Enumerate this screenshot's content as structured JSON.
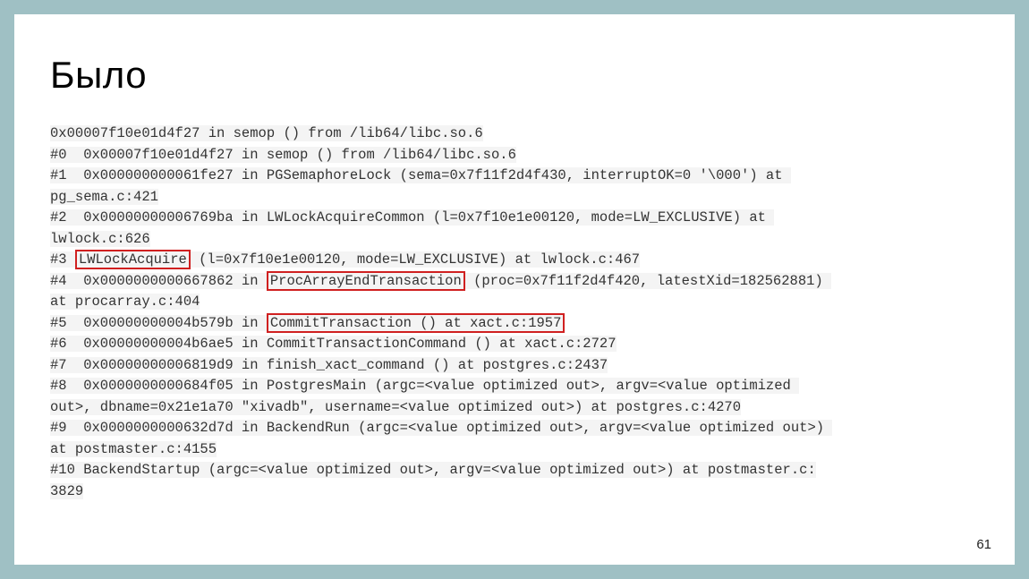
{
  "title": "Было",
  "page_number": "61",
  "stack": {
    "l0": "0x00007f10e01d4f27 in semop () from /lib64/libc.so.6",
    "l1": "#0  0x00007f10e01d4f27 in semop () from /lib64/libc.so.6",
    "l2": "#1  0x000000000061fe27 in PGSemaphoreLock (sema=0x7f11f2d4f430, interruptOK=0 '\\000') at ",
    "l2b": "pg_sema.c:421",
    "l3": "#2  0x00000000006769ba in LWLockAcquireCommon (l=0x7f10e1e00120, mode=LW_EXCLUSIVE) at ",
    "l3b": "lwlock.c:626",
    "l4a": "#3 ",
    "l4h": "LWLockAcquire",
    "l4b": " (l=0x7f10e1e00120, mode=LW_EXCLUSIVE) at lwlock.c:467",
    "l5a": "#4  0x0000000000667862 in ",
    "l5h": "ProcArrayEndTransaction",
    "l5b": " (proc=0x7f11f2d4f420, latestXid=182562881) ",
    "l5c": "at procarray.c:404",
    "l6a": "#5  0x00000000004b579b in ",
    "l6h": "CommitTransaction () at xact.c:1957",
    "l7": "#6  0x00000000004b6ae5 in CommitTransactionCommand () at xact.c:2727",
    "l8": "#7  0x00000000006819d9 in finish_xact_command () at postgres.c:2437",
    "l9": "#8  0x0000000000684f05 in PostgresMain (argc=<value optimized out>, argv=<value optimized ",
    "l9b": "out>, dbname=0x21e1a70 \"xivadb\", username=<value optimized out>) at postgres.c:4270",
    "l10": "#9  0x0000000000632d7d in BackendRun (argc=<value optimized out>, argv=<value optimized out>) ",
    "l10b": "at postmaster.c:4155",
    "l11": "#10 BackendStartup (argc=<value optimized out>, argv=<value optimized out>) at postmaster.c:",
    "l11b": "3829"
  }
}
